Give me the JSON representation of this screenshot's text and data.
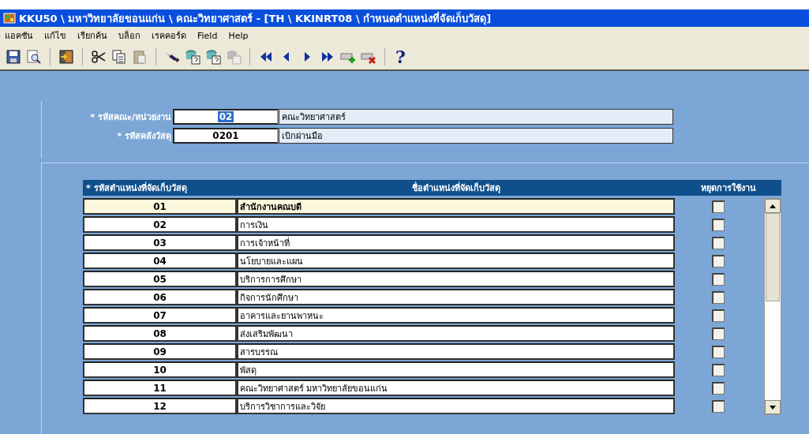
{
  "window": {
    "title": "KKU50 \\ มหาวิทยาลัยขอนแก่น \\ คณะวิทยาศาสตร์ - [TH \\ KKINRT08 \\ กำหนดตำแหน่งที่จัดเก็บวัสดุ]"
  },
  "menu": [
    "แอคชัน",
    "แก้ไข",
    "เรียกค้น",
    "บล็อก",
    "เรคคอร์ด",
    "Field",
    "Help"
  ],
  "toolbar": [
    {
      "kind": "save"
    },
    {
      "kind": "preview"
    },
    {
      "kind": "sep"
    },
    {
      "kind": "exit"
    },
    {
      "kind": "sep"
    },
    {
      "kind": "cut"
    },
    {
      "kind": "copy"
    },
    {
      "kind": "paste"
    },
    {
      "kind": "sep"
    },
    {
      "kind": "filter"
    },
    {
      "kind": "query"
    },
    {
      "kind": "query"
    },
    {
      "kind": "query-disabled"
    },
    {
      "kind": "sep"
    },
    {
      "kind": "first"
    },
    {
      "kind": "prev"
    },
    {
      "kind": "next"
    },
    {
      "kind": "last"
    },
    {
      "kind": "insert"
    },
    {
      "kind": "delete"
    },
    {
      "kind": "sep"
    },
    {
      "kind": "help",
      "label": "?"
    }
  ],
  "fields": [
    {
      "label": "* รหัสคณะ/หน่วยงาน",
      "value": "02",
      "description": "คณะวิทยาศาสตร์",
      "selected": true
    },
    {
      "label": "* รหัสคลังวัสดุ",
      "value": "0201",
      "description": "เบิกผ่านมือ",
      "selected": false
    }
  ],
  "table": {
    "columns": [
      "* รหัสตำแหน่งที่จัดเก็บวัสดุ",
      "ชื่อตำแหน่งที่จัดเก็บวัสดุ",
      "หยุดการใช้งาน"
    ],
    "rows": [
      {
        "code": "01",
        "name": "สำนักงานคณบดี",
        "disabled": false,
        "selected": true
      },
      {
        "code": "02",
        "name": "การเงิน",
        "disabled": false,
        "selected": false
      },
      {
        "code": "03",
        "name": "การเจ้าหน้าที่",
        "disabled": false,
        "selected": false
      },
      {
        "code": "04",
        "name": "นโยบายและแผน",
        "disabled": false,
        "selected": false
      },
      {
        "code": "05",
        "name": "บริการการศึกษา",
        "disabled": false,
        "selected": false
      },
      {
        "code": "06",
        "name": "กิจการนักศึกษา",
        "disabled": false,
        "selected": false
      },
      {
        "code": "07",
        "name": "อาคารและยานพาหนะ",
        "disabled": false,
        "selected": false
      },
      {
        "code": "08",
        "name": "ส่งเสริมพัฒนา",
        "disabled": false,
        "selected": false
      },
      {
        "code": "09",
        "name": "สารบรรณ",
        "disabled": false,
        "selected": false
      },
      {
        "code": "10",
        "name": "พัสดุ",
        "disabled": false,
        "selected": false
      },
      {
        "code": "11",
        "name": "คณะวิทยาศาสตร์ มหาวิทยาลัยขอนแก่น",
        "disabled": false,
        "selected": false
      },
      {
        "code": "12",
        "name": "บริการวิชาการและวิจัย",
        "disabled": false,
        "selected": false
      }
    ]
  }
}
